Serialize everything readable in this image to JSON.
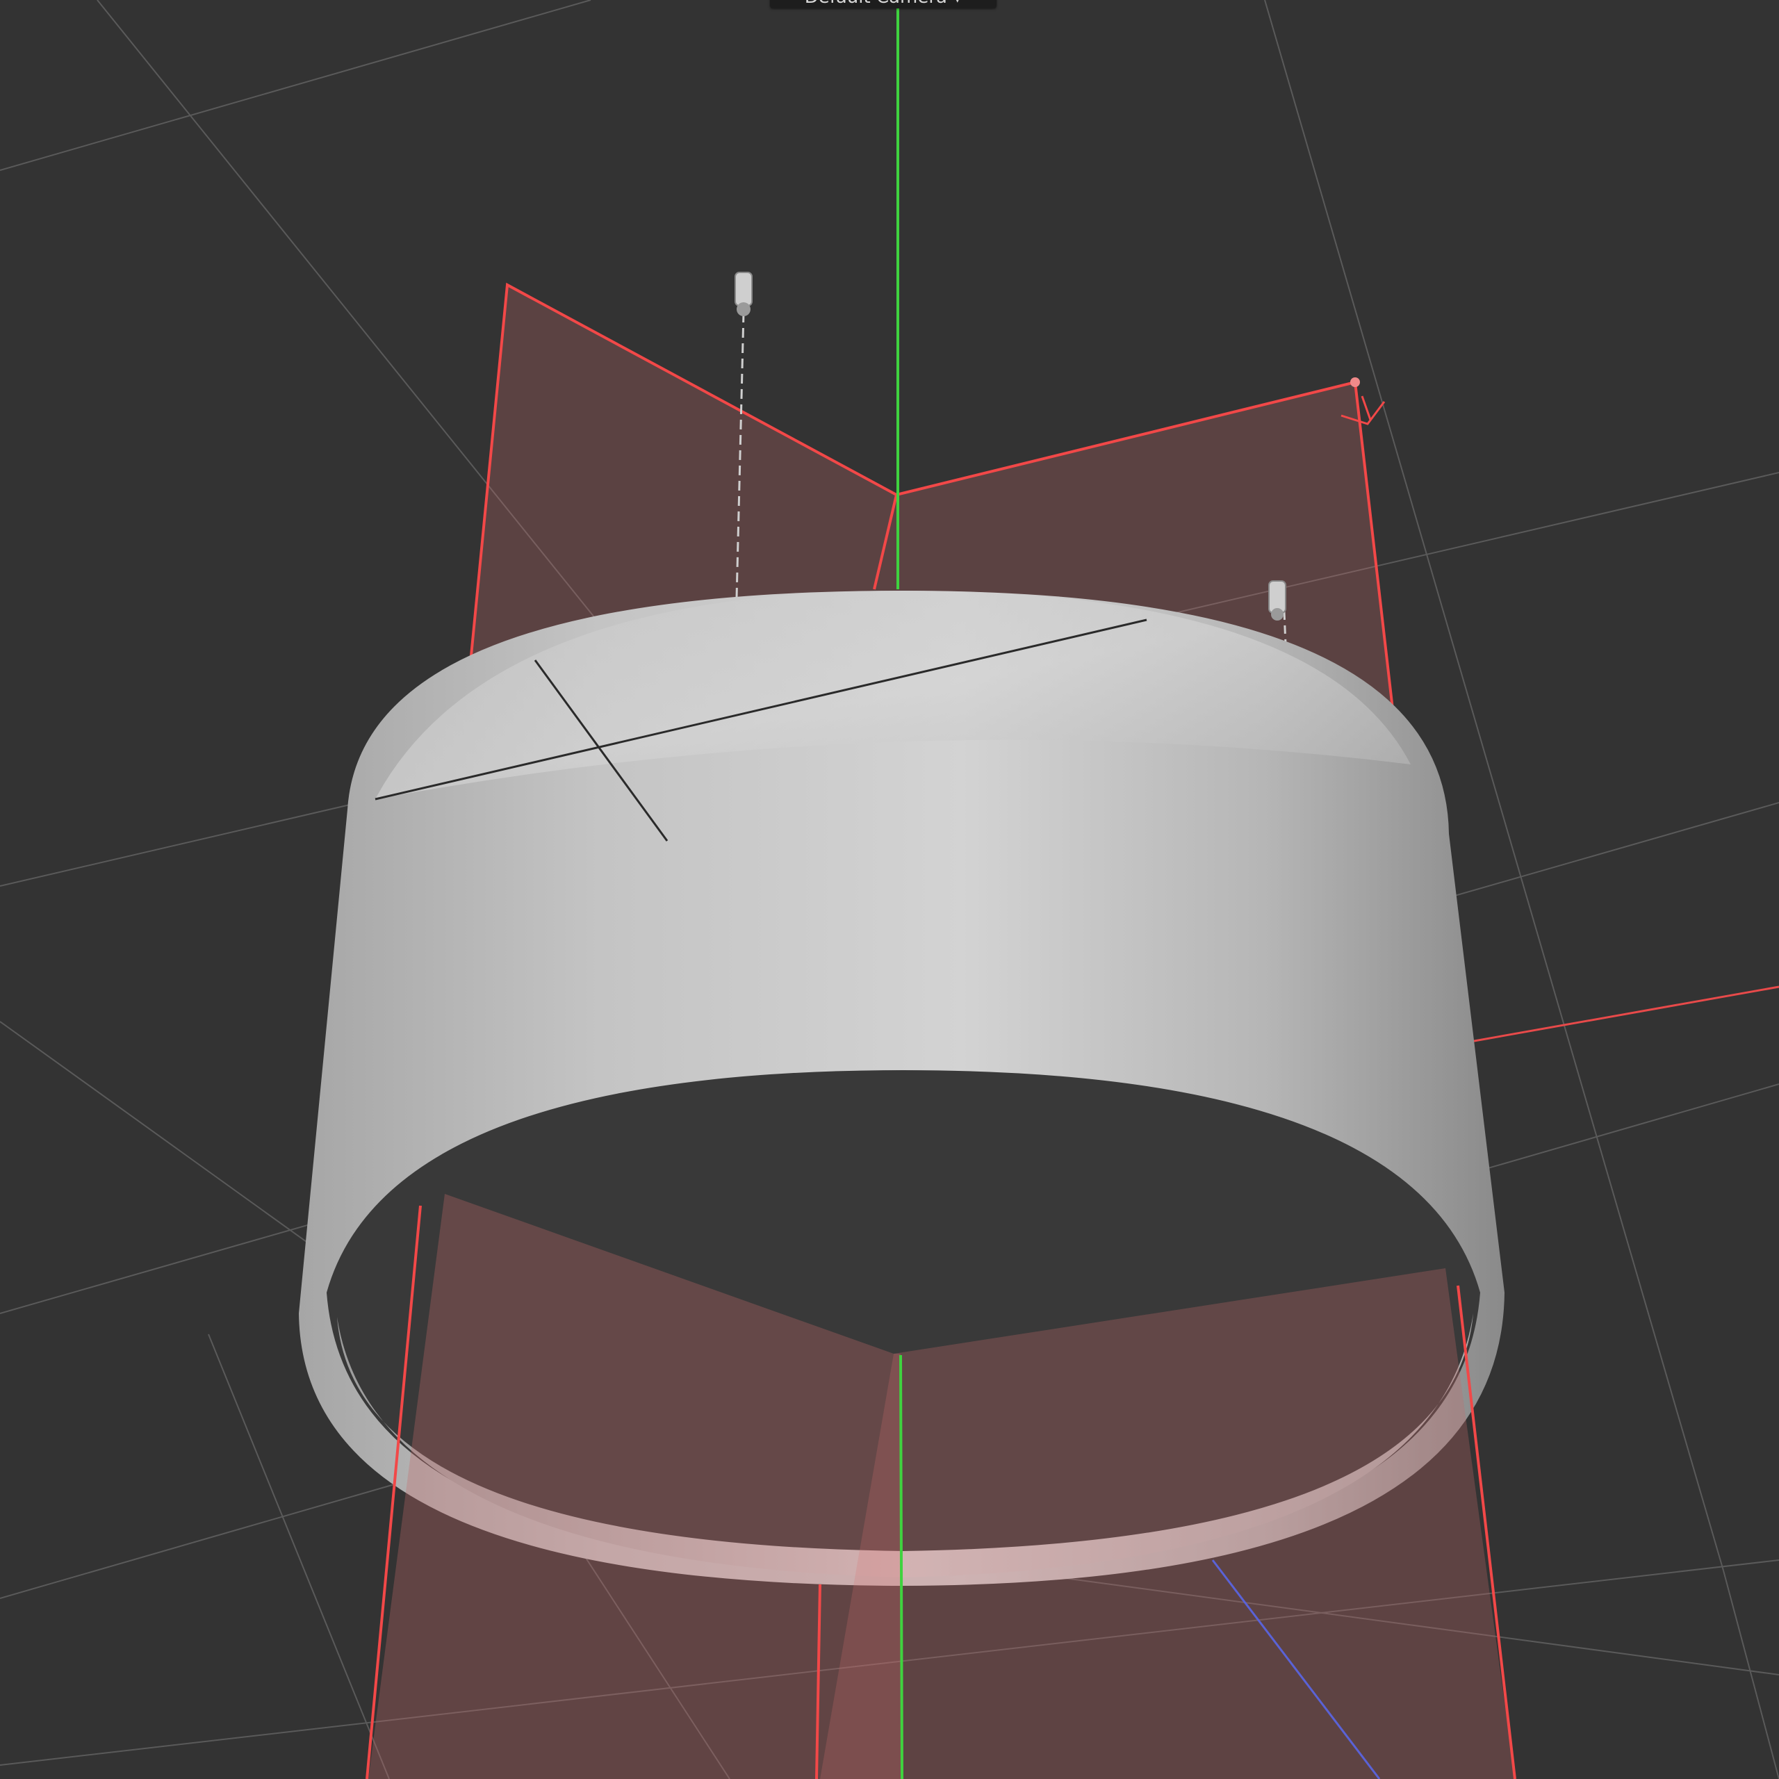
{
  "viewport": {
    "camera_label": "Default Camera",
    "camera_menu_glyph": "▾"
  },
  "colors": {
    "background": "#333333",
    "grid": "#5a5a5a",
    "y_axis": "#3fd33f",
    "x_axis": "#e84a4a",
    "z_axis": "#5a62d6",
    "plane_fill": "#c46a6a",
    "plane_edge": "#f24848",
    "cylinder_light": "#d4d4d4",
    "cylinder_dark": "#8c8c8c"
  },
  "icons": {
    "light_probe_left": "light-probe-icon",
    "light_probe_right": "light-probe-icon",
    "cylinder": "cylinder-mesh-icon"
  }
}
